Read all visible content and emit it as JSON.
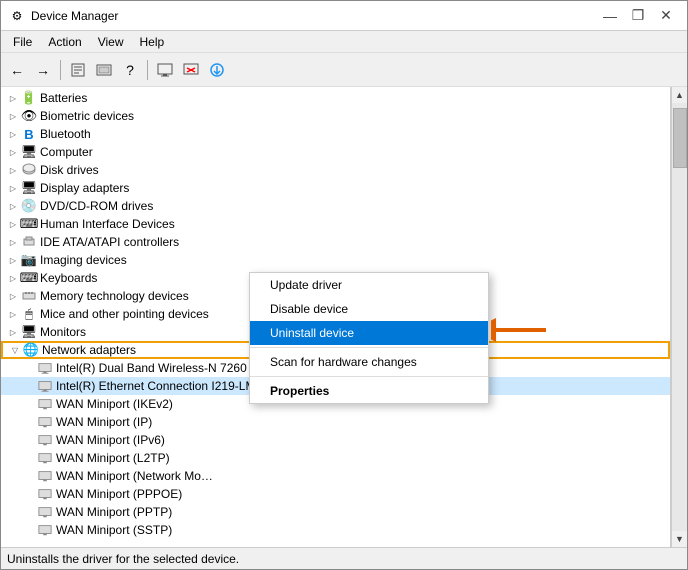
{
  "window": {
    "title": "Device Manager",
    "icon": "⚙"
  },
  "title_controls": {
    "minimize": "—",
    "restore": "❐",
    "close": "✕"
  },
  "menu": {
    "items": [
      "File",
      "Action",
      "View",
      "Help"
    ]
  },
  "toolbar": {
    "buttons": [
      "←",
      "→",
      "📋",
      "📄",
      "?",
      "📃",
      "🖥",
      "❌",
      "⬇"
    ]
  },
  "tree": {
    "items": [
      {
        "id": "batteries",
        "label": "Batteries",
        "icon": "🔋",
        "indent": 1,
        "expanded": false,
        "expand": "▷"
      },
      {
        "id": "biometric",
        "label": "Biometric devices",
        "icon": "👁",
        "indent": 1,
        "expanded": false,
        "expand": "▷"
      },
      {
        "id": "bluetooth",
        "label": "Bluetooth",
        "icon": "B",
        "indent": 1,
        "expanded": false,
        "expand": "▷"
      },
      {
        "id": "computer",
        "label": "Computer",
        "icon": "🖥",
        "indent": 1,
        "expanded": false,
        "expand": "▷"
      },
      {
        "id": "disk",
        "label": "Disk drives",
        "icon": "💾",
        "indent": 1,
        "expanded": false,
        "expand": "▷"
      },
      {
        "id": "display",
        "label": "Display adapters",
        "icon": "🖥",
        "indent": 1,
        "expanded": false,
        "expand": "▷"
      },
      {
        "id": "dvd",
        "label": "DVD/CD-ROM drives",
        "icon": "💿",
        "indent": 1,
        "expanded": false,
        "expand": "▷"
      },
      {
        "id": "hid",
        "label": "Human Interface Devices",
        "icon": "⌨",
        "indent": 1,
        "expanded": false,
        "expand": "▷"
      },
      {
        "id": "ide",
        "label": "IDE ATA/ATAPI controllers",
        "icon": "🔌",
        "indent": 1,
        "expanded": false,
        "expand": "▷"
      },
      {
        "id": "imaging",
        "label": "Imaging devices",
        "icon": "📷",
        "indent": 1,
        "expanded": false,
        "expand": "▷"
      },
      {
        "id": "keyboards",
        "label": "Keyboards",
        "icon": "⌨",
        "indent": 1,
        "expanded": false,
        "expand": "▷"
      },
      {
        "id": "memory",
        "label": "Memory technology devices",
        "icon": "📋",
        "indent": 1,
        "expanded": false,
        "expand": "▷"
      },
      {
        "id": "mice",
        "label": "Mice and other pointing devices",
        "icon": "🖱",
        "indent": 1,
        "expanded": false,
        "expand": "▷"
      },
      {
        "id": "monitors",
        "label": "Monitors",
        "icon": "🖥",
        "indent": 1,
        "expanded": false,
        "expand": "▷"
      },
      {
        "id": "network",
        "label": "Network adapters",
        "icon": "🌐",
        "indent": 1,
        "expanded": true,
        "expand": "▽",
        "highlighted": true
      },
      {
        "id": "intel_wifi",
        "label": "Intel(R) Dual Band Wireless-N 7260",
        "icon": "📡",
        "indent": 2,
        "expanded": false
      },
      {
        "id": "intel_eth",
        "label": "Intel(R) Ethernet Connection I219-LM #2",
        "icon": "📡",
        "indent": 2,
        "expanded": false,
        "selected": true
      },
      {
        "id": "wan_ikev2",
        "label": "WAN Miniport (IKEv2)",
        "icon": "📡",
        "indent": 2
      },
      {
        "id": "wan_ip",
        "label": "WAN Miniport (IP)",
        "icon": "📡",
        "indent": 2
      },
      {
        "id": "wan_ipv6",
        "label": "WAN Miniport (IPv6)",
        "icon": "📡",
        "indent": 2
      },
      {
        "id": "wan_l2tp",
        "label": "WAN Miniport (L2TP)",
        "icon": "📡",
        "indent": 2
      },
      {
        "id": "wan_net",
        "label": "WAN Miniport (Network Mo…",
        "icon": "📡",
        "indent": 2
      },
      {
        "id": "wan_pppoe",
        "label": "WAN Miniport (PPPOE)",
        "icon": "📡",
        "indent": 2
      },
      {
        "id": "wan_pptp",
        "label": "WAN Miniport (PPTP)",
        "icon": "📡",
        "indent": 2
      },
      {
        "id": "wan_sstp",
        "label": "WAN Miniport (SSTP)",
        "icon": "📡",
        "indent": 2
      }
    ]
  },
  "context_menu": {
    "items": [
      {
        "label": "Update driver",
        "bold": false,
        "active": false
      },
      {
        "label": "Disable device",
        "bold": false,
        "active": false
      },
      {
        "label": "Uninstall device",
        "bold": false,
        "active": true
      },
      {
        "sep": true
      },
      {
        "label": "Scan for hardware changes",
        "bold": false,
        "active": false
      },
      {
        "sep": true
      },
      {
        "label": "Properties",
        "bold": true,
        "active": false
      }
    ]
  },
  "status_bar": {
    "text": "Uninstalls the driver for the selected device."
  }
}
